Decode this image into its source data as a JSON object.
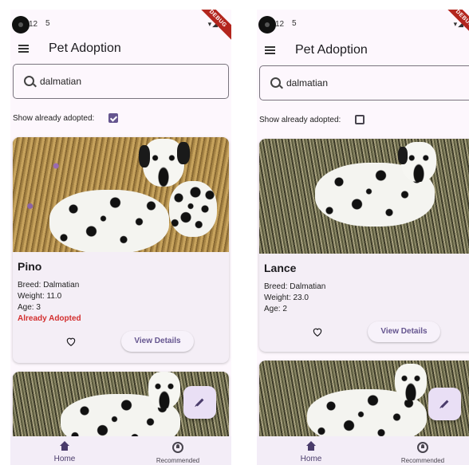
{
  "status_bar": {
    "time": "12",
    "sim": "5",
    "debug_banner": "DEBUG"
  },
  "app_bar": {
    "title": "Pet Adoption"
  },
  "colors": {
    "accent": "#65558f",
    "adopted": "#d32f2f",
    "surface": "#fdf7fd"
  },
  "screens": [
    {
      "search": {
        "value": "dalmatian"
      },
      "filter": {
        "label": "Show already adopted:",
        "checked": true
      },
      "cards": [
        {
          "name": "Pino",
          "breed": "Breed: Dalmatian",
          "weight": "Weight: 11.0",
          "age": "Age: 3",
          "status": "Already Adopted",
          "details_label": "View Details"
        }
      ]
    },
    {
      "search": {
        "value": "dalmatian"
      },
      "filter": {
        "label": "Show already adopted:",
        "checked": false
      },
      "cards": [
        {
          "name": "Lance",
          "breed": "Breed: Dalmatian",
          "weight": "Weight: 23.0",
          "age": "Age: 2",
          "details_label": "View Details"
        }
      ]
    }
  ],
  "bottom_nav": {
    "home": "Home",
    "recommended": "Recommended"
  },
  "icons": [
    "menu-icon",
    "search-icon",
    "heart-icon",
    "edit-icon",
    "home-icon",
    "recommended-icon"
  ]
}
